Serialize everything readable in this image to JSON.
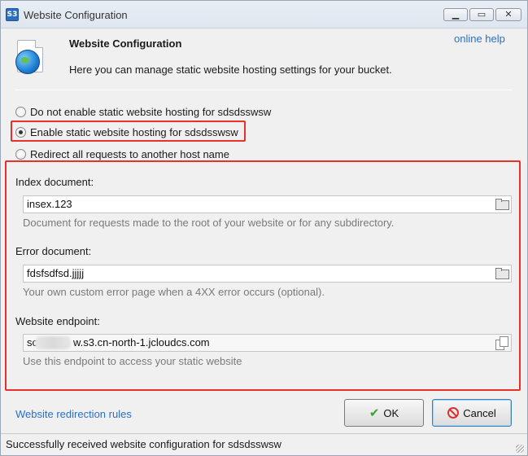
{
  "window": {
    "title": "Website Configuration",
    "app_icon_text": "S3",
    "min_icon": "minimize-icon",
    "max_icon": "maximize-icon",
    "close_icon": "close-icon"
  },
  "header": {
    "title": "Website Configuration",
    "description": "Here you can manage static website hosting settings for your bucket.",
    "online_help": "online help",
    "icon": "globe-document-icon"
  },
  "hosting_options": [
    {
      "label": "Do not enable static website hosting for sdsdsswsw",
      "selected": false
    },
    {
      "label": "Enable static website hosting for sdsdsswsw",
      "selected": true
    },
    {
      "label": "Redirect all requests to another host name",
      "selected": false
    }
  ],
  "fields": {
    "index": {
      "label": "Index document:",
      "value": "insex.123",
      "hint": "Document for requests made to the root of your website or for any subdirectory.",
      "icon": "folder-icon"
    },
    "error": {
      "label": "Error document:",
      "value": "fdsfsdfsd.jjjjj",
      "hint": "Your own custom error page when a 4XX error occurs (optional).",
      "icon": "folder-icon"
    },
    "endpoint": {
      "label": "Website endpoint:",
      "value_prefix": "sc",
      "value_suffix": "w.s3.cn-north-1.jcloudcs.com",
      "hint": "Use this endpoint to access your static website",
      "icon": "copy-icon"
    }
  },
  "footer": {
    "redirection_link": "Website redirection rules",
    "ok_label": "OK",
    "cancel_label": "Cancel",
    "status": "Successfully received website configuration for sdsdsswsw"
  },
  "colors": {
    "highlight": "#e8302f",
    "link": "#2a6fc9"
  }
}
